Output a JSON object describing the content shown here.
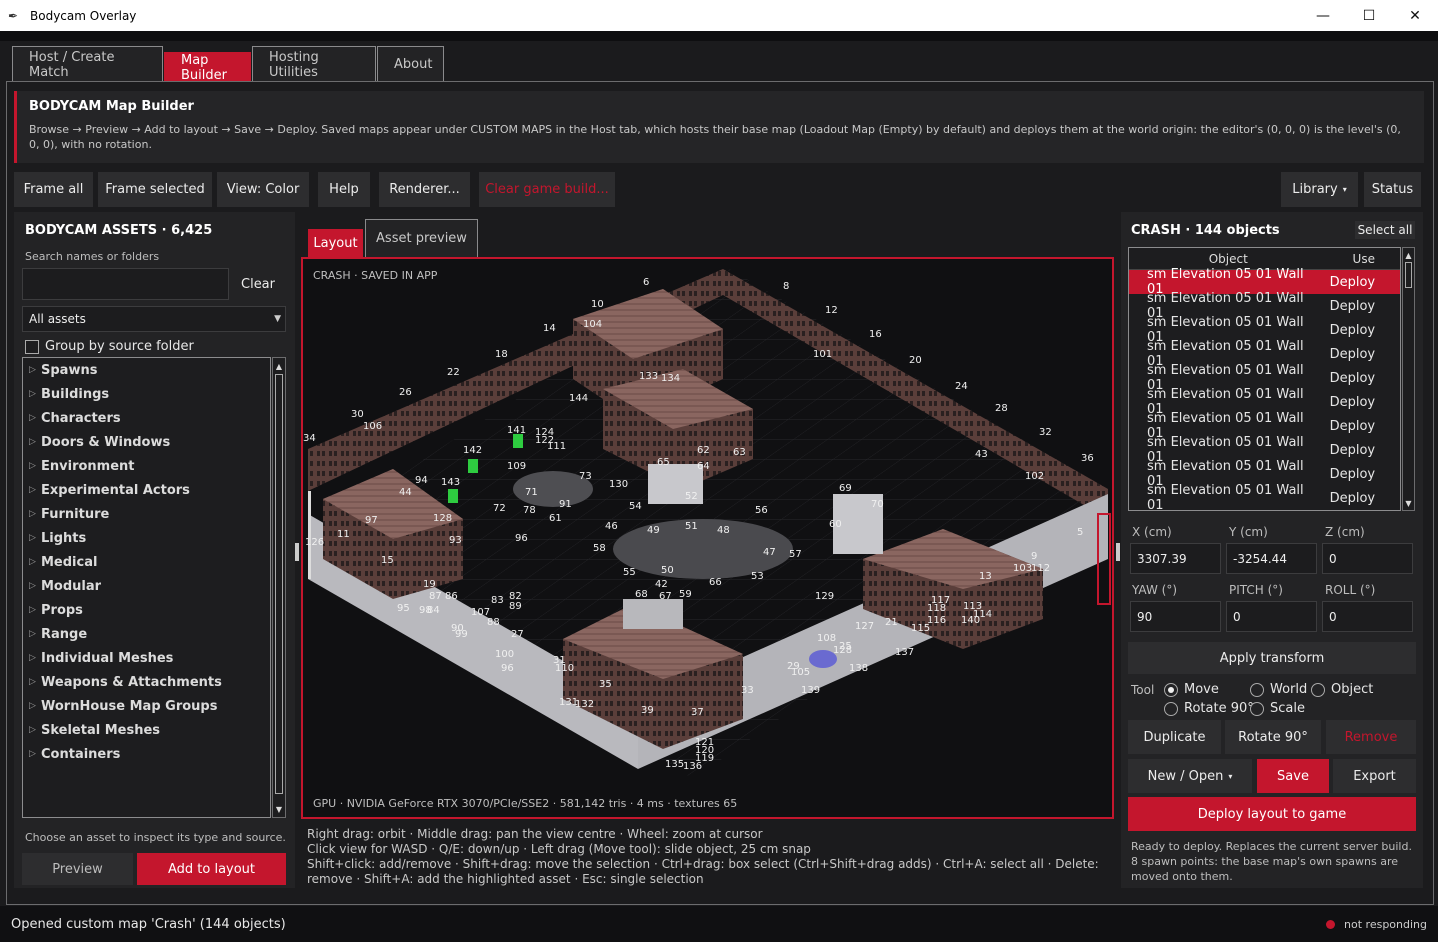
{
  "window": {
    "title": "Bodycam Overlay",
    "minimize": "—",
    "maximize": "☐",
    "close": "✕"
  },
  "tabs": [
    {
      "label": "Host / Create Match"
    },
    {
      "label": "Map Builder"
    },
    {
      "label": "Hosting Utilities"
    },
    {
      "label": "About"
    }
  ],
  "banner": {
    "title": "BODYCAM Map Builder",
    "desc": "Browse → Preview → Add to layout → Save → Deploy. Saved maps appear under CUSTOM MAPS in the Host tab, which hosts their base map (Loadout Map (Empty) by default) and deploys them at the world origin: the editor's (0, 0, 0) is the level's (0, 0, 0), with no rotation."
  },
  "toolbar": {
    "frame_all": "Frame all",
    "frame_selected": "Frame selected",
    "view_color": "View: Color",
    "help": "Help",
    "renderer": "Renderer...",
    "clear_build": "Clear game build...",
    "library": "Library",
    "status": "Status"
  },
  "assets": {
    "title": "BODYCAM ASSETS · 6,425",
    "search_label": "Search names or folders",
    "search_value": "",
    "clear": "Clear",
    "filter": "All assets",
    "group_by": "Group by source folder",
    "categories": [
      "Spawns",
      "Buildings",
      "Characters",
      "Doors & Windows",
      "Environment",
      "Experimental Actors",
      "Furniture",
      "Lights",
      "Medical",
      "Modular",
      "Props",
      "Range",
      "Individual Meshes",
      "Weapons & Attachments",
      "WornHouse Map Groups",
      "Skeletal Meshes",
      "Containers"
    ],
    "hint": "Choose an asset to inspect its type and source.",
    "preview": "Preview",
    "add": "Add to layout"
  },
  "viewport": {
    "tab_layout": "Layout",
    "tab_preview": "Asset preview",
    "caption": "CRASH · SAVED IN APP",
    "gpu": "GPU · NVIDIA GeForce RTX 3070/PCIe/SSE2 · 581,142 tris · 4 ms · textures 65",
    "help": "Right drag: orbit · Middle drag: pan the view centre · Wheel: zoom at cursor\nClick view for WASD · Q/E: down/up · Left drag (Move tool): slide object, 25 cm snap\nShift+click: add/remove · Shift+drag: move the selection · Ctrl+drag: box select (Ctrl+Shift+drag adds) · Ctrl+A: select all · Delete: remove · Shift+A: add the highlighted asset · Esc: single selection",
    "labels": [
      "6",
      "8",
      "10",
      "12",
      "14",
      "104",
      "16",
      "18",
      "101",
      "20",
      "22",
      "133",
      "134",
      "24",
      "26",
      "144",
      "28",
      "30",
      "106",
      "32",
      "34",
      "141",
      "124",
      "122",
      "111",
      "62",
      "63",
      "142",
      "65",
      "64",
      "43",
      "36",
      "109",
      "73",
      "102",
      "143",
      "94",
      "44",
      "130",
      "71",
      "69",
      "70",
      "72",
      "78",
      "91",
      "52",
      "54",
      "56",
      "97",
      "128",
      "61",
      "60",
      "5",
      "11",
      "93",
      "96",
      "46",
      "49",
      "51",
      "48",
      "58",
      "47",
      "57",
      "126",
      "15",
      "50",
      "55",
      "53",
      "42",
      "9",
      "103",
      "112",
      "13",
      "19",
      "87",
      "86",
      "83",
      "82",
      "68",
      "59",
      "67",
      "66",
      "129",
      "95",
      "98",
      "84",
      "107",
      "89",
      "117",
      "118",
      "116",
      "113",
      "114",
      "88",
      "27",
      "127",
      "21",
      "115",
      "140",
      "90",
      "99",
      "108",
      "25",
      "128",
      "137",
      "31",
      "110",
      "100",
      "96",
      "29",
      "105",
      "138",
      "35",
      "139",
      "33",
      "131",
      "132",
      "39",
      "37",
      "121",
      "120",
      "119",
      "135",
      "136"
    ]
  },
  "objects": {
    "title": "CRASH · 144 objects",
    "select_all": "Select all",
    "col_object": "Object",
    "col_use": "Use",
    "rows": [
      {
        "name": "sm Elevation 05 01 Wall 01",
        "use": "Deploy"
      },
      {
        "name": "sm Elevation 05 01 Wall 01",
        "use": "Deploy"
      },
      {
        "name": "sm Elevation 05 01 Wall 01",
        "use": "Deploy"
      },
      {
        "name": "sm Elevation 05 01 Wall 01",
        "use": "Deploy"
      },
      {
        "name": "sm Elevation 05 01 Wall 01",
        "use": "Deploy"
      },
      {
        "name": "sm Elevation 05 01 Wall 01",
        "use": "Deploy"
      },
      {
        "name": "sm Elevation 05 01 Wall 01",
        "use": "Deploy"
      },
      {
        "name": "sm Elevation 05 01 Wall 01",
        "use": "Deploy"
      },
      {
        "name": "sm Elevation 05 01 Wall 01",
        "use": "Deploy"
      },
      {
        "name": "sm Elevation 05 01 Wall 01",
        "use": "Deploy"
      }
    ]
  },
  "transform": {
    "x_label": "X (cm)",
    "y_label": "Y (cm)",
    "z_label": "Z (cm)",
    "x": "3307.39",
    "y": "-3254.44",
    "z": "0",
    "yaw_label": "YAW (°)",
    "pitch_label": "PITCH (°)",
    "roll_label": "ROLL (°)",
    "yaw": "90",
    "pitch": "0",
    "roll": "0",
    "apply": "Apply transform",
    "tool_label": "Tool",
    "move": "Move",
    "rotate": "Rotate 90°",
    "world": "World",
    "object": "Object",
    "scale": "Scale",
    "duplicate": "Duplicate",
    "rotate_btn": "Rotate 90°",
    "remove": "Remove",
    "new_open": "New / Open",
    "save": "Save",
    "export": "Export",
    "deploy": "Deploy layout to game",
    "ready": "Ready to deploy. Replaces the current server build. 8 spawn points: the base map's own spawns are moved onto them."
  },
  "status": {
    "message": "Opened custom map 'Crash' (144 objects)",
    "state": "not responding"
  },
  "colors": {
    "accent": "#c4162d"
  }
}
